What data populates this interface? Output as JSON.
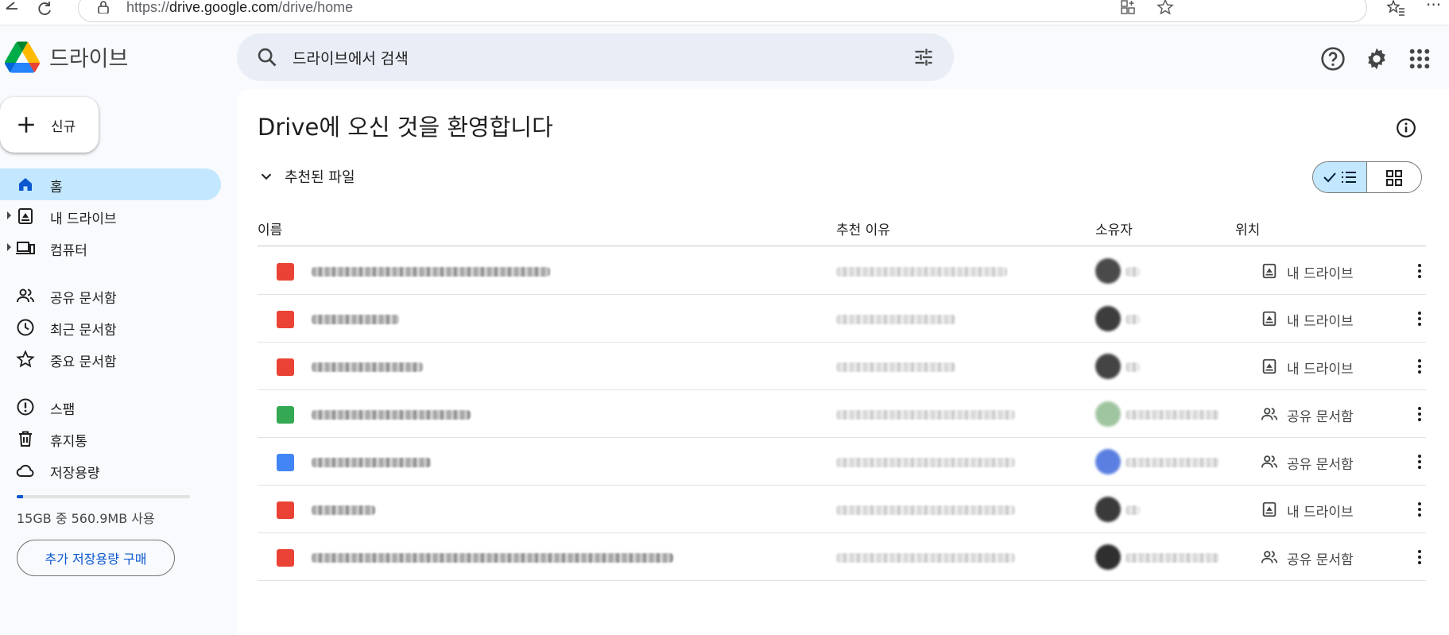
{
  "browser": {
    "url_prefix": "https://",
    "url_host": "drive.google.com",
    "url_path": "/drive/home"
  },
  "app": {
    "logo_text": "드라이브"
  },
  "search": {
    "placeholder": "드라이브에서 검색"
  },
  "sidebar": {
    "new_label": "신규",
    "items": [
      {
        "label": "홈",
        "icon": "home-icon",
        "active": true
      },
      {
        "label": "내 드라이브",
        "icon": "my-drive-icon"
      },
      {
        "label": "컴퓨터",
        "icon": "computers-icon"
      },
      {
        "label": "공유 문서함",
        "icon": "shared-icon"
      },
      {
        "label": "최근 문서함",
        "icon": "clock-icon"
      },
      {
        "label": "중요 문서함",
        "icon": "star-icon"
      },
      {
        "label": "스팸",
        "icon": "spam-icon"
      },
      {
        "label": "휴지통",
        "icon": "trash-icon"
      },
      {
        "label": "저장용량",
        "icon": "cloud-icon"
      }
    ],
    "storage_text": "15GB 중 560.9MB 사용",
    "storage_fraction": 0.037,
    "buy_label": "추가 저장용량 구매"
  },
  "main": {
    "welcome": "Drive에 오신 것을 환영합니다",
    "section_label": "추천된 파일",
    "columns": [
      "이름",
      "추천 이유",
      "소유자",
      "위치"
    ],
    "rows": [
      {
        "type": "image",
        "location": "내 드라이브",
        "loc_icon": "my-drive-icon"
      },
      {
        "type": "video",
        "location": "내 드라이브",
        "loc_icon": "my-drive-icon"
      },
      {
        "type": "video",
        "location": "내 드라이브",
        "loc_icon": "my-drive-icon"
      },
      {
        "type": "sheets",
        "location": "공유 문서함",
        "loc_icon": "shared-icon"
      },
      {
        "type": "docs",
        "location": "공유 문서함",
        "loc_icon": "shared-icon"
      },
      {
        "type": "pdf",
        "location": "내 드라이브",
        "loc_icon": "my-drive-icon"
      },
      {
        "type": "pdf",
        "location": "공유 문서함",
        "loc_icon": "shared-icon"
      }
    ]
  },
  "colors": {
    "accent": "#0b57d0",
    "active_bg": "#c2e7ff",
    "search_bg": "#e9eef6",
    "page_bg": "#f8fafd"
  }
}
